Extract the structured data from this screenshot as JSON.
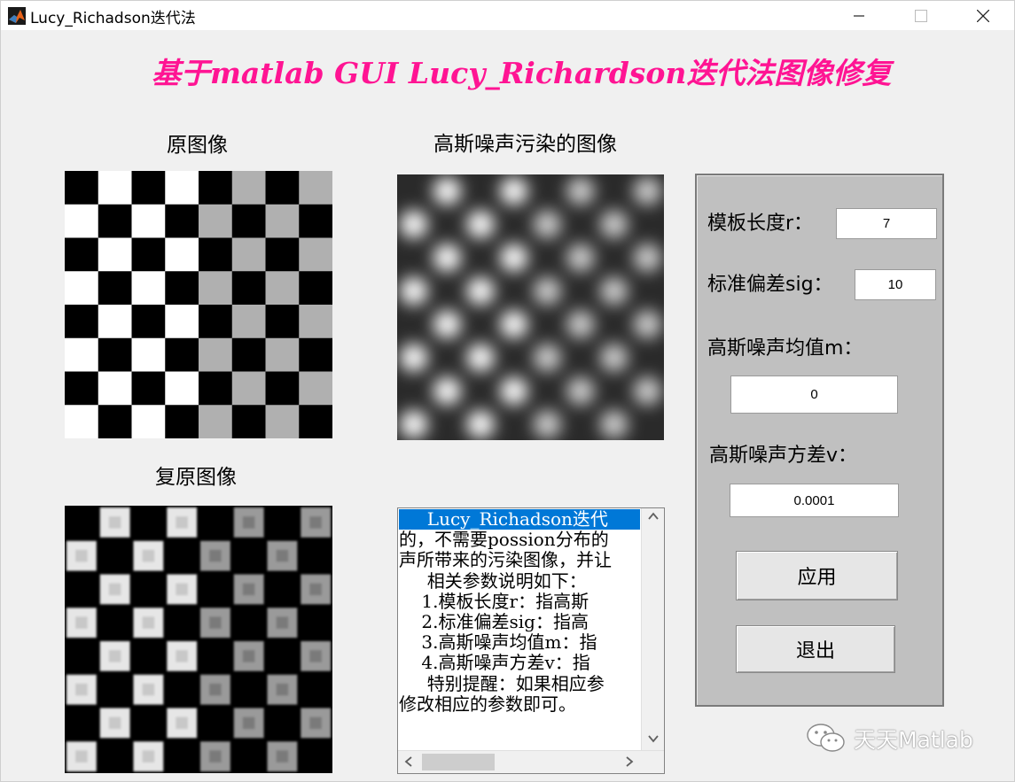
{
  "window": {
    "title": "Lucy_Richadson迭代法",
    "controls": [
      "minimize",
      "maximize",
      "close"
    ]
  },
  "header": {
    "title": "基于matlab GUI Lucy_Richardson迭代法图像修复",
    "title_color": "#ff1493"
  },
  "images": {
    "original_label": "原图像",
    "noisy_label": "高斯噪声污染的图像",
    "restored_label": "复原图像"
  },
  "panel": {
    "template_length_label": "模板长度r：",
    "template_length_value": "7",
    "std_dev_label": "标准偏差sig：",
    "std_dev_value": "10",
    "noise_mean_label": "高斯噪声均值m：",
    "noise_mean_value": "0",
    "noise_var_label": "高斯噪声方差v：",
    "noise_var_value": "0.0001",
    "apply_label": "应用",
    "exit_label": "退出"
  },
  "listbox": {
    "lines": [
      "     Lucy_Richadson迭代",
      "的，不需要possion分布的",
      "声所带来的污染图像，并让",
      "     相关参数说明如下：",
      "    1.模板长度r：指高斯",
      "    2.标准偏差sig：指高",
      "    3.高斯噪声均值m：指",
      "    4.高斯噪声方差v：指",
      "     特别提醒：如果相应参",
      "修改相应的参数即可。"
    ],
    "selected_index": 0,
    "selection_color": "#0078d7"
  },
  "watermark": {
    "text": "天天Matlab",
    "icon": "wechat-icon"
  }
}
